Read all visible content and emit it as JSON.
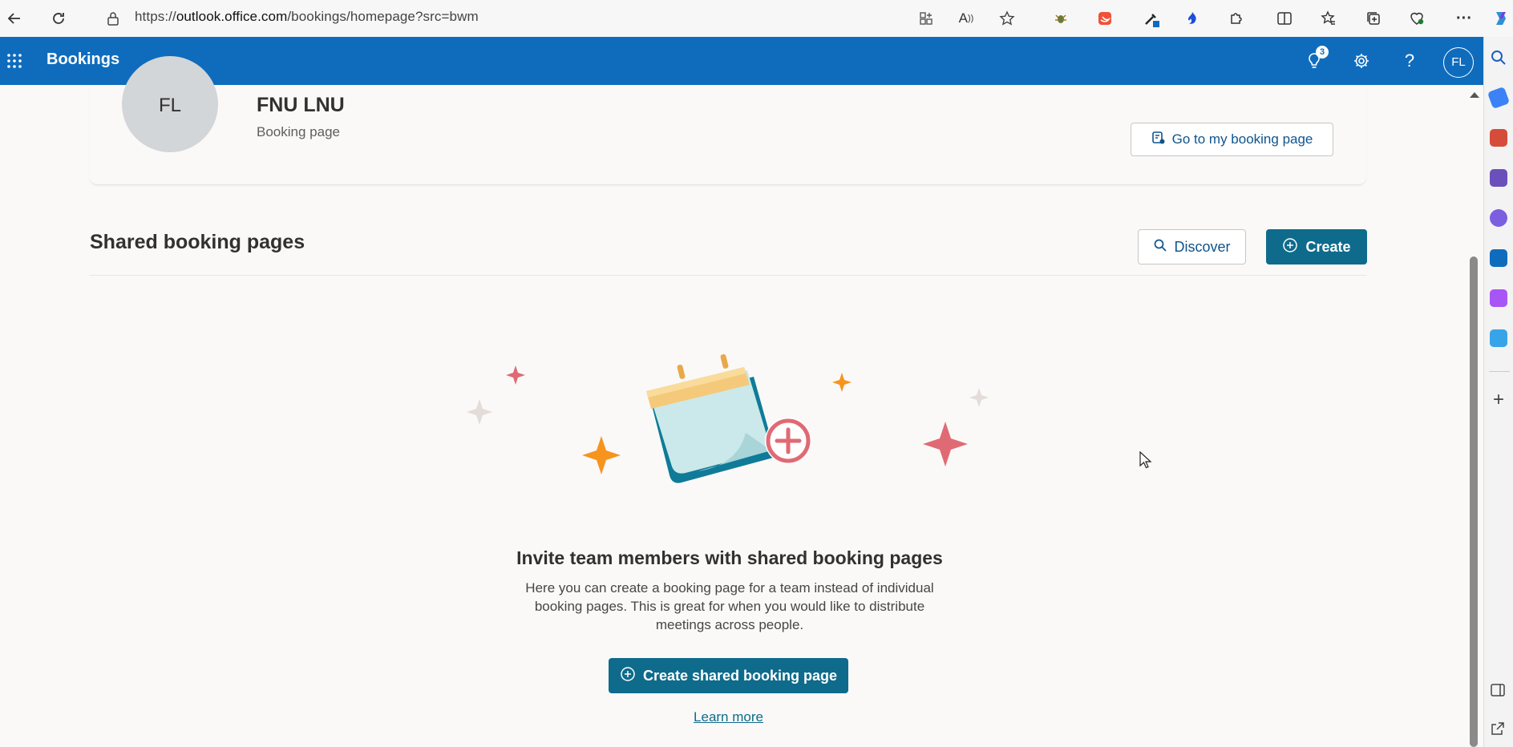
{
  "browser": {
    "url_prefix": "https://",
    "url_host": "outlook.office.com",
    "url_path": "/bookings/homepage?src=bwm"
  },
  "appbar": {
    "title": "Bookings",
    "notification_count": "3",
    "user_initials": "FL"
  },
  "profile": {
    "initials": "FL",
    "name": "FNU LNU",
    "subtitle": "Booking page",
    "goto_label": "Go to my booking page"
  },
  "shared": {
    "title": "Shared booking pages",
    "discover_label": "Discover",
    "create_label": "Create"
  },
  "empty_state": {
    "title": "Invite team members with shared booking pages",
    "line1": "Here you can create a booking page for a team instead of individual",
    "line2": "booking pages. This is great for when you would like to distribute",
    "line3": "meetings across people.",
    "cta_label": "Create shared booking page",
    "learn_more": "Learn more"
  },
  "colors": {
    "brand_blue": "#0f6cbd",
    "teal_button": "#0f6b8c"
  }
}
